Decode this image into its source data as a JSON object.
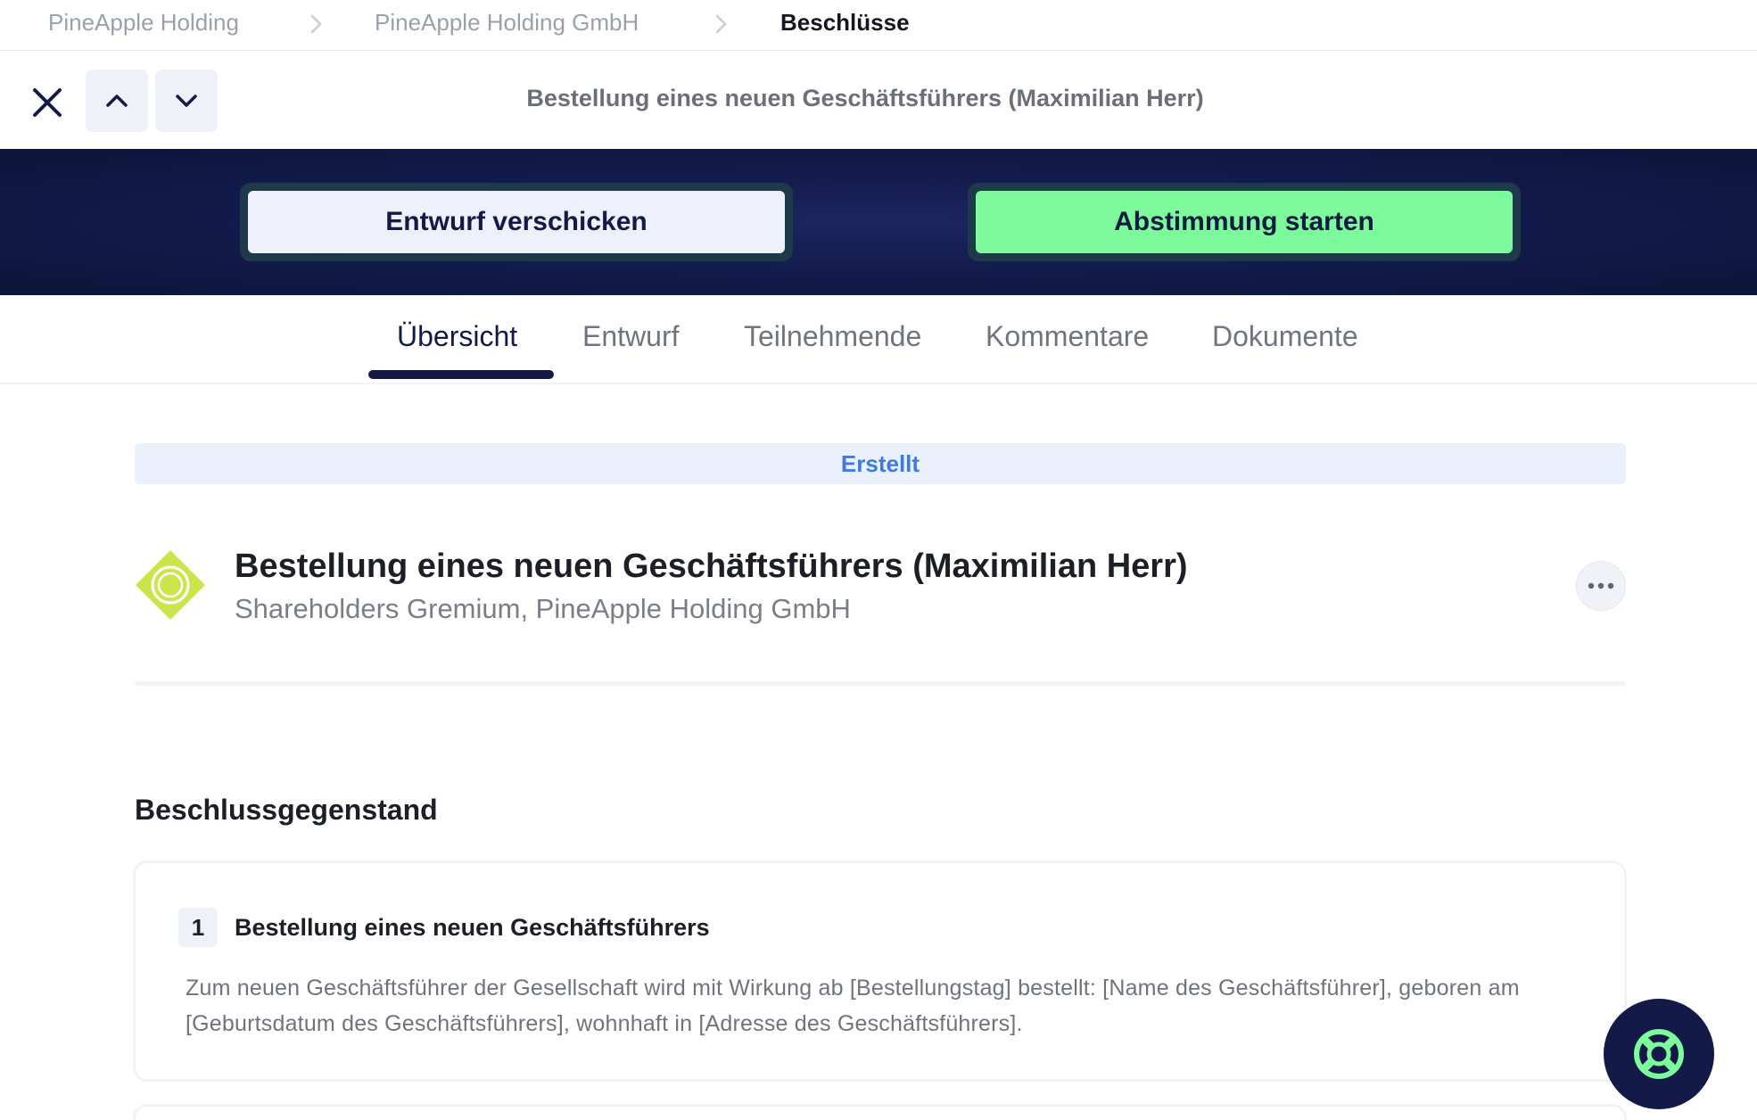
{
  "breadcrumb": {
    "items": [
      "PineApple Holding",
      "PineApple Holding GmbH",
      "Beschlüsse"
    ]
  },
  "toolbar": {
    "title": "Bestellung eines neuen Geschäftsführers (Maximilian Herr)"
  },
  "actions": {
    "send_draft_label": "Entwurf verschicken",
    "start_vote_label": "Abstimmung starten"
  },
  "tabs": [
    {
      "label": "Übersicht",
      "active": true
    },
    {
      "label": "Entwurf",
      "active": false
    },
    {
      "label": "Teilnehmende",
      "active": false
    },
    {
      "label": "Kommentare",
      "active": false
    },
    {
      "label": "Dokumente",
      "active": false
    }
  ],
  "status": {
    "label": "Erstellt"
  },
  "resolution": {
    "title": "Bestellung eines neuen Geschäftsführers (Maximilian Herr)",
    "subtitle": "Shareholders Gremium, PineApple Holding GmbH",
    "icon": "diamond-target-icon"
  },
  "subject": {
    "heading": "Beschlussgegenstand",
    "items": [
      {
        "number": "1",
        "title": "Bestellung eines neuen Geschäftsführers",
        "text": "Zum neuen Geschäftsführer der Gesellschaft wird mit Wirkung ab [Bestellungstag] bestellt: [Name des Geschäftsführer], geboren am [Geburtsdatum des Geschäftsführers], wohnhaft in [Adresse des Geschäftsführers]."
      }
    ]
  },
  "colors": {
    "navy": "#131a47",
    "accent_green": "#7dfb9c",
    "status_blue": "#3e7be0",
    "icon_lime": "#cde44a"
  }
}
